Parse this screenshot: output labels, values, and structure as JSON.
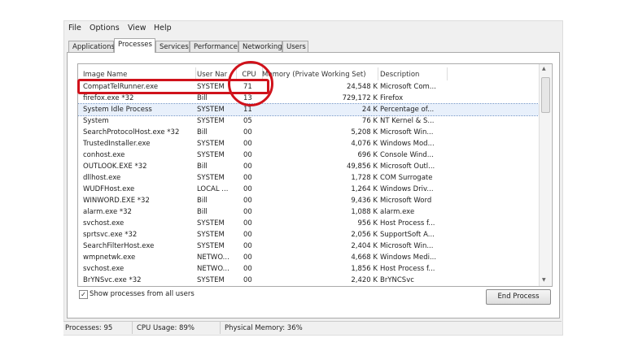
{
  "menu": [
    "File",
    "Options",
    "View",
    "Help"
  ],
  "tabs": [
    "Applications",
    "Processes",
    "Services",
    "Performance",
    "Networking",
    "Users"
  ],
  "active_tab": "Processes",
  "columns": [
    "Image Name",
    "User Nar",
    "CPU",
    "Memory (Private Working Set)",
    "Description"
  ],
  "rows": [
    [
      "CompatTelRunner.exe",
      "SYSTEM",
      "71",
      "24,548 K",
      "Microsoft Com..."
    ],
    [
      "firefox.exe *32",
      "Bill",
      "13",
      "729,172 K",
      "Firefox"
    ],
    [
      "System Idle Process",
      "SYSTEM",
      "11",
      "24 K",
      "Percentage of..."
    ],
    [
      "System",
      "SYSTEM",
      "05",
      "76 K",
      "NT Kernel & S..."
    ],
    [
      "SearchProtocolHost.exe *32",
      "Bill",
      "00",
      "5,208 K",
      "Microsoft Win..."
    ],
    [
      "TrustedInstaller.exe",
      "SYSTEM",
      "00",
      "4,076 K",
      "Windows Mod..."
    ],
    [
      "conhost.exe",
      "SYSTEM",
      "00",
      "696 K",
      "Console Wind..."
    ],
    [
      "OUTLOOK.EXE *32",
      "Bill",
      "00",
      "49,856 K",
      "Microsoft Outl..."
    ],
    [
      "dllhost.exe",
      "SYSTEM",
      "00",
      "1,728 K",
      "COM Surrogate"
    ],
    [
      "WUDFHost.exe",
      "LOCAL ...",
      "00",
      "1,264 K",
      "Windows Driv..."
    ],
    [
      "WINWORD.EXE *32",
      "Bill",
      "00",
      "9,436 K",
      "Microsoft Word"
    ],
    [
      "alarm.exe *32",
      "Bill",
      "00",
      "1,088 K",
      "alarm.exe"
    ],
    [
      "svchost.exe",
      "SYSTEM",
      "00",
      "956 K",
      "Host Process f..."
    ],
    [
      "sprtsvc.exe *32",
      "SYSTEM",
      "00",
      "2,056 K",
      "SupportSoft A..."
    ],
    [
      "SearchFilterHost.exe",
      "SYSTEM",
      "00",
      "2,404 K",
      "Microsoft Win..."
    ],
    [
      "wmpnetwk.exe",
      "NETWO...",
      "00",
      "4,668 K",
      "Windows Medi..."
    ],
    [
      "svchost.exe",
      "NETWO...",
      "00",
      "1,856 K",
      "Host Process f..."
    ],
    [
      "BrYNSvc.exe *32",
      "SYSTEM",
      "00",
      "2,420 K",
      "BrYNCSvc"
    ]
  ],
  "selected_row": 2,
  "show_all_label": "Show processes from all users",
  "show_all_checked": true,
  "end_process_label": "End Process",
  "status": {
    "processes": "Processes: 95",
    "cpu": "CPU Usage: 89%",
    "memory": "Physical Memory: 36%"
  },
  "annotation_color": "#d0121b"
}
